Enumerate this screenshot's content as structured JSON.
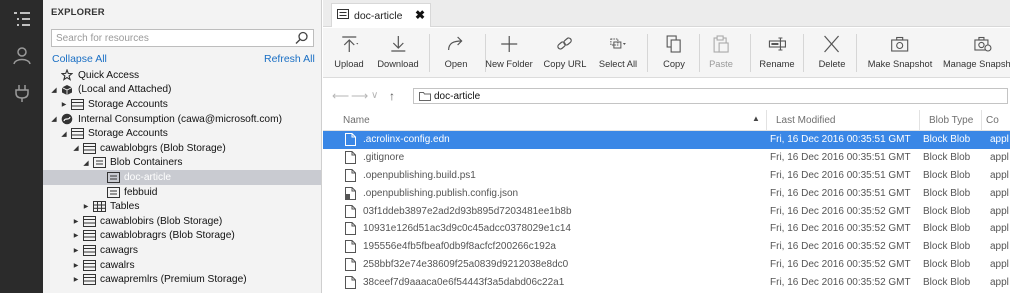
{
  "explorer": {
    "title": "EXPLORER",
    "search_placeholder": "Search for resources",
    "collapse_all": "Collapse All",
    "refresh_all": "Refresh All",
    "tree": [
      {
        "label": "Quick Access",
        "level": 0,
        "twisty": "",
        "icon": "quick-access-icon"
      },
      {
        "label": "(Local and Attached)",
        "level": 0,
        "twisty": "open",
        "icon": "cube-icon"
      },
      {
        "label": "Storage Accounts",
        "level": 1,
        "twisty": "closed",
        "icon": "storage-accounts-icon"
      },
      {
        "label": "Internal Consumption (cawa@microsoft.com)",
        "level": 0,
        "twisty": "open",
        "icon": "subscription-icon"
      },
      {
        "label": "Storage Accounts",
        "level": 1,
        "twisty": "open",
        "icon": "storage-accounts-icon"
      },
      {
        "label": "cawablobgrs (Blob Storage)",
        "level": 2,
        "twisty": "open",
        "icon": "storage-account-icon"
      },
      {
        "label": "Blob Containers",
        "level": 3,
        "twisty": "open",
        "icon": "blob-containers-icon"
      },
      {
        "label": "doc-article",
        "level": 4,
        "twisty": "",
        "icon": "container-icon",
        "selected": true
      },
      {
        "label": "febbuid",
        "level": 4,
        "twisty": "",
        "icon": "container-icon"
      },
      {
        "label": "Tables",
        "level": 3,
        "twisty": "closed",
        "icon": "table-icon"
      },
      {
        "label": "cawablobirs (Blob Storage)",
        "level": 2,
        "twisty": "closed",
        "icon": "storage-account-icon"
      },
      {
        "label": "cawablobragrs (Blob Storage)",
        "level": 2,
        "twisty": "closed",
        "icon": "storage-account-icon"
      },
      {
        "label": "cawagrs",
        "level": 2,
        "twisty": "closed",
        "icon": "storage-account-icon"
      },
      {
        "label": "cawalrs",
        "level": 2,
        "twisty": "closed",
        "icon": "storage-account-icon"
      },
      {
        "label": "cawapremlrs (Premium Storage)",
        "level": 2,
        "twisty": "closed",
        "icon": "storage-account-icon"
      }
    ]
  },
  "tab": {
    "label": "doc-article",
    "close": "✖"
  },
  "toolbar": [
    {
      "label": "Upload",
      "icon": "upload-icon",
      "disabled": false
    },
    {
      "label": "Download",
      "icon": "download-icon",
      "disabled": false
    },
    {
      "label": "Open",
      "icon": "open-icon",
      "disabled": false
    },
    {
      "label": "New Folder",
      "icon": "plus-icon",
      "disabled": false
    },
    {
      "label": "Copy URL",
      "icon": "link-icon",
      "disabled": false
    },
    {
      "label": "Select All",
      "icon": "select-all-icon",
      "disabled": false
    },
    {
      "label": "Copy",
      "icon": "copy-icon",
      "disabled": false
    },
    {
      "label": "Paste",
      "icon": "paste-icon",
      "disabled": true
    },
    {
      "label": "Rename",
      "icon": "rename-icon",
      "disabled": false
    },
    {
      "label": "Delete",
      "icon": "delete-icon",
      "disabled": false
    },
    {
      "label": "Make Snapshot",
      "icon": "camera-icon",
      "disabled": false
    },
    {
      "label": "Manage Snapshots",
      "icon": "manage-snapshots-icon",
      "disabled": false
    }
  ],
  "navigation": {
    "path": "doc-article"
  },
  "grid": {
    "columns": [
      "Name",
      "Last Modified",
      "Blob Type",
      "Co"
    ],
    "rows": [
      {
        "name": ".acrolinx-config.edn",
        "modified": "Fri, 16 Dec 2016 00:35:51 GMT",
        "type": "Block Blob",
        "content": "appl",
        "selected": true
      },
      {
        "name": ".gitignore",
        "modified": "Fri, 16 Dec 2016 00:35:51 GMT",
        "type": "Block Blob",
        "content": "appl"
      },
      {
        "name": ".openpublishing.build.ps1",
        "modified": "Fri, 16 Dec 2016 00:35:51 GMT",
        "type": "Block Blob",
        "content": "appl"
      },
      {
        "name": ".openpublishing.publish.config.json",
        "modified": "Fri, 16 Dec 2016 00:35:51 GMT",
        "type": "Block Blob",
        "content": "appl"
      },
      {
        "name": "03f1ddeb3897e2ad2d93b895d7203481ee1b8b",
        "modified": "Fri, 16 Dec 2016 00:35:52 GMT",
        "type": "Block Blob",
        "content": "appl"
      },
      {
        "name": "10931e126d51ac3d9c0c45adcc0378029e1c14",
        "modified": "Fri, 16 Dec 2016 00:35:52 GMT",
        "type": "Block Blob",
        "content": "appl"
      },
      {
        "name": "195556e4fb5fbeaf0db9f8acfcf200266c192a",
        "modified": "Fri, 16 Dec 2016 00:35:52 GMT",
        "type": "Block Blob",
        "content": "appl"
      },
      {
        "name": "258bbf32e74e38609f25a0839d9212038e8dc0",
        "modified": "Fri, 16 Dec 2016 00:35:52 GMT",
        "type": "Block Blob",
        "content": "appl"
      },
      {
        "name": "38ceef7d9aaaca0e6f54443f3a5dabd06c22a1",
        "modified": "Fri, 16 Dec 2016 00:35:52 GMT",
        "type": "Block Blob",
        "content": "appl"
      }
    ]
  }
}
